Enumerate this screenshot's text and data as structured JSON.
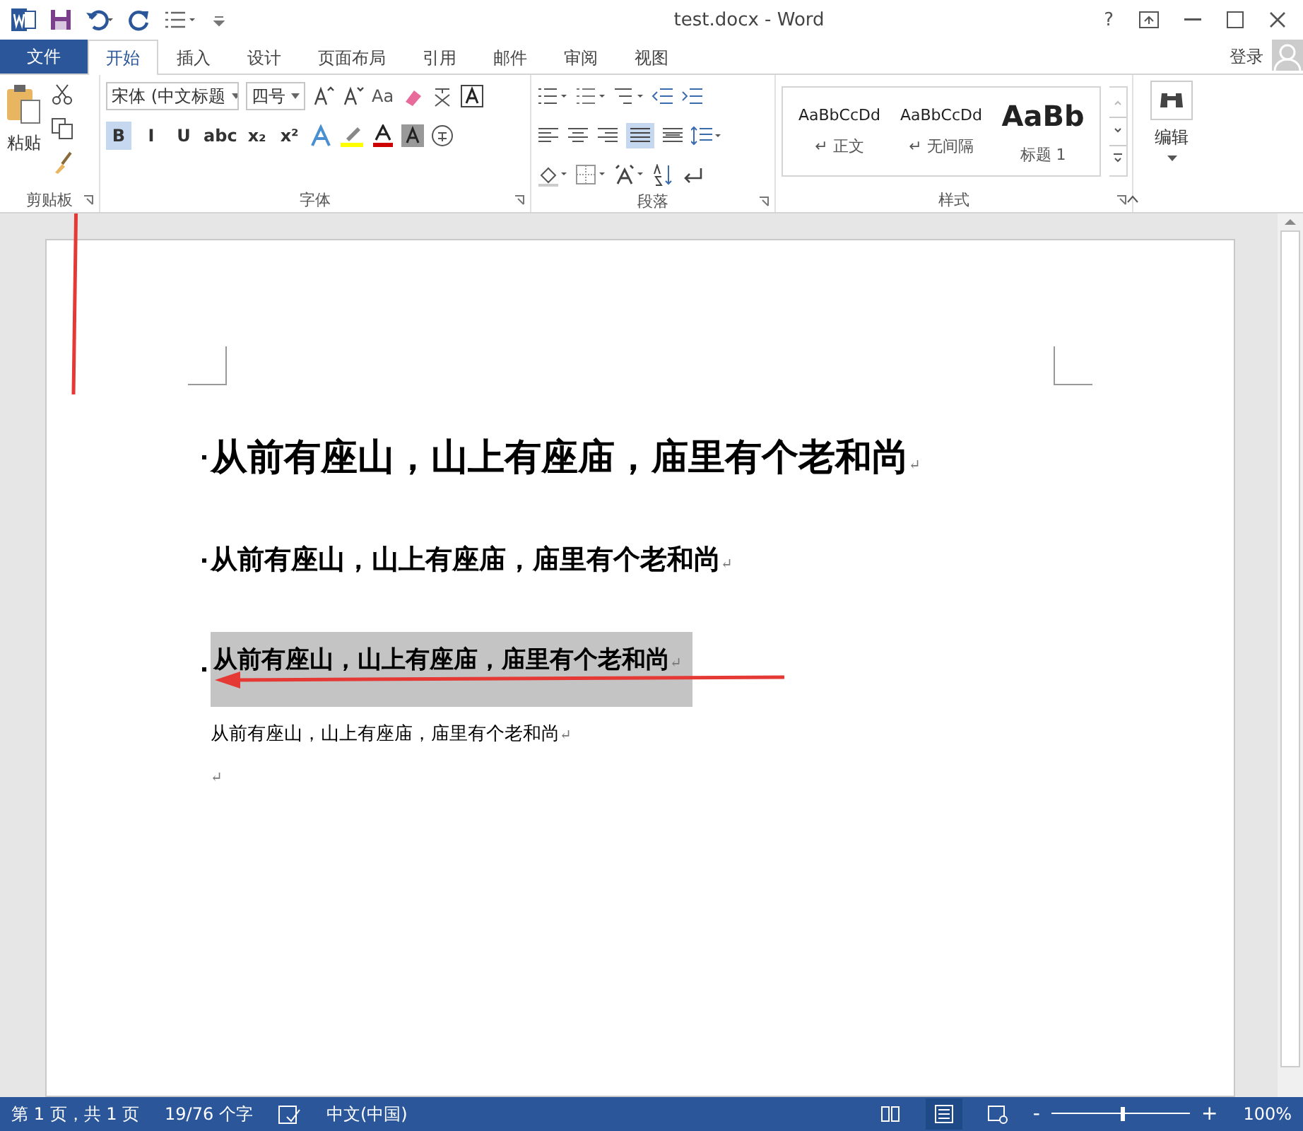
{
  "window": {
    "title": "test.docx - Word",
    "help": "?",
    "sign_in": "登录"
  },
  "tabs": [
    {
      "label": "文件",
      "kind": "file",
      "selected": false
    },
    {
      "label": "开始",
      "kind": "tab",
      "selected": true
    },
    {
      "label": "插入",
      "kind": "tab",
      "selected": false
    },
    {
      "label": "设计",
      "kind": "tab",
      "selected": false
    },
    {
      "label": "页面布局",
      "kind": "tab",
      "selected": false
    },
    {
      "label": "引用",
      "kind": "tab",
      "selected": false
    },
    {
      "label": "邮件",
      "kind": "tab",
      "selected": false
    },
    {
      "label": "审阅",
      "kind": "tab",
      "selected": false
    },
    {
      "label": "视图",
      "kind": "tab",
      "selected": false
    }
  ],
  "ribbon": {
    "clipboard": {
      "paste": "粘贴",
      "label": "剪贴板"
    },
    "font": {
      "font_name": "宋体 (中文标题",
      "font_size": "四号",
      "case_button": "Aa",
      "format_buttons": [
        {
          "label": "B",
          "selected": true
        },
        {
          "label": "I",
          "selected": false
        },
        {
          "label": "U",
          "selected": false
        },
        {
          "label": "abc",
          "selected": false
        },
        {
          "label": "x₂",
          "selected": false
        },
        {
          "label": "x²",
          "selected": false
        }
      ],
      "label": "字体"
    },
    "paragraph": {
      "label": "段落"
    },
    "styles": {
      "items": [
        {
          "preview": "AaBbCcDd",
          "name": "↵ 正文",
          "kind": "normal"
        },
        {
          "preview": "AaBbCcDd",
          "name": "↵ 无间隔",
          "kind": "normal"
        },
        {
          "preview": "AaBb",
          "name": "标题 1",
          "kind": "heading"
        }
      ],
      "label": "样式"
    },
    "editing": {
      "label": "编辑"
    }
  },
  "document": {
    "paragraphs": [
      {
        "text": "从前有座山，山上有座庙，庙里有个老和尚",
        "mark": "↵",
        "kind": "large",
        "selected": false
      },
      {
        "text": "从前有座山，山上有座庙，庙里有个老和尚",
        "mark": "↵",
        "kind": "medium",
        "selected": false
      },
      {
        "text": "从前有座山，山上有座庙，庙里有个老和尚",
        "mark": "↵",
        "kind": "small",
        "selected": true
      },
      {
        "text": "从前有座山，山上有座庙，庙里有个老和尚",
        "mark": "↵",
        "kind": "body",
        "selected": false
      },
      {
        "mark": "↵",
        "kind": "body",
        "selected": false
      }
    ]
  },
  "status_bar": {
    "page": "第 1 页，共 1 页",
    "words": "19/76 个字",
    "language": "中文(中国)",
    "zoom": {
      "level": 0.5,
      "reading": "100%",
      "minus": "-",
      "plus": "+"
    }
  }
}
